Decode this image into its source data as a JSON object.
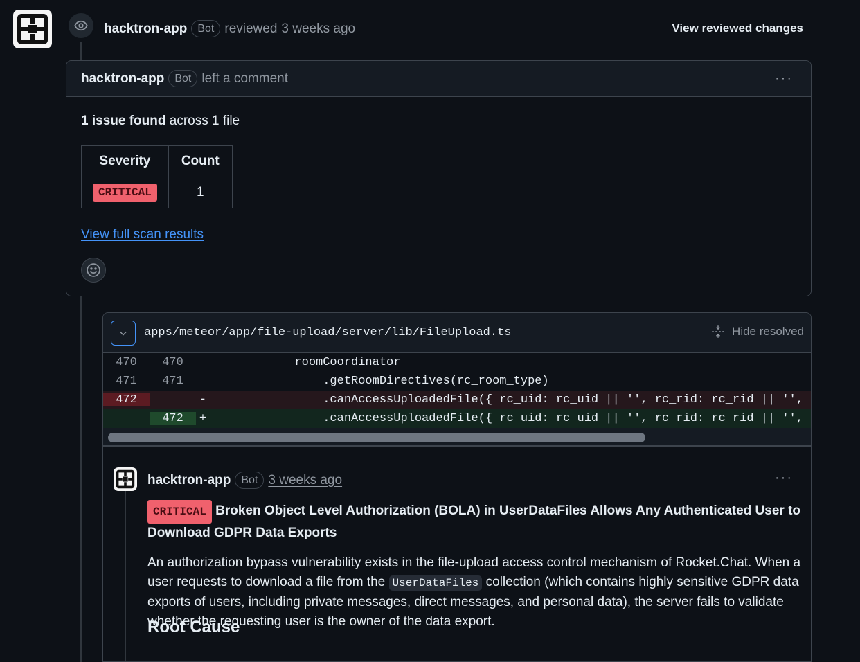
{
  "review": {
    "author": "hacktron-app",
    "bot_label": "Bot",
    "action": "reviewed",
    "time_ago": "3 weeks ago",
    "view_changes": "View reviewed changes"
  },
  "comment": {
    "author": "hacktron-app",
    "bot_label": "Bot",
    "action": "left a comment",
    "menu": "···",
    "issues_count": "1 issue found",
    "issues_rest": " across 1 file",
    "table": {
      "headers": [
        "Severity",
        "Count"
      ],
      "rows": [
        {
          "severity": "CRITICAL",
          "count": "1"
        }
      ]
    },
    "scan_link": "View full scan results"
  },
  "file": {
    "path": "apps/meteor/app/file-upload/server/lib/FileUpload.ts",
    "hide_resolved": "Hide resolved",
    "lines": [
      {
        "old": "470",
        "new": "470",
        "marker": "",
        "code": "            roomCoordinator"
      },
      {
        "old": "471",
        "new": "471",
        "marker": "",
        "code": "                .getRoomDirectives(rc_room_type)"
      },
      {
        "old": "472",
        "new": "",
        "marker": "-",
        "code": "                .canAccessUploadedFile({ rc_uid: rc_uid || '', rc_rid: rc_rid || '', rc_t"
      },
      {
        "old": "",
        "new": "472",
        "marker": "+",
        "code": "                .canAccessUploadedFile({ rc_uid: rc_uid || '', rc_rid: rc_rid || '', rc_t"
      }
    ]
  },
  "thread": {
    "author": "hacktron-app",
    "bot_label": "Bot",
    "time_ago": "3 weeks ago",
    "menu": "···",
    "severity": "CRITICAL",
    "title": "Broken Object Level Authorization (BOLA) in UserDataFiles Allows Any Authenticated User to Download GDPR Data Exports",
    "desc_part1": "An authorization bypass vulnerability exists in the file-upload access control mechanism of Rocket.Chat. When a user requests to download a file from the ",
    "desc_code": "UserDataFiles",
    "desc_part2": " collection (which contains highly sensitive GDPR data exports of users, including private messages, direct messages, and personal data), the server fails to validate whether the requesting user is the owner of the data export.",
    "next_heading": "Root Cause"
  },
  "colors": {
    "background": "#0d1117",
    "critical": "#f0616d",
    "link": "#4493f8",
    "deletion": "#5c1b22",
    "addition": "#1f4a2c"
  }
}
